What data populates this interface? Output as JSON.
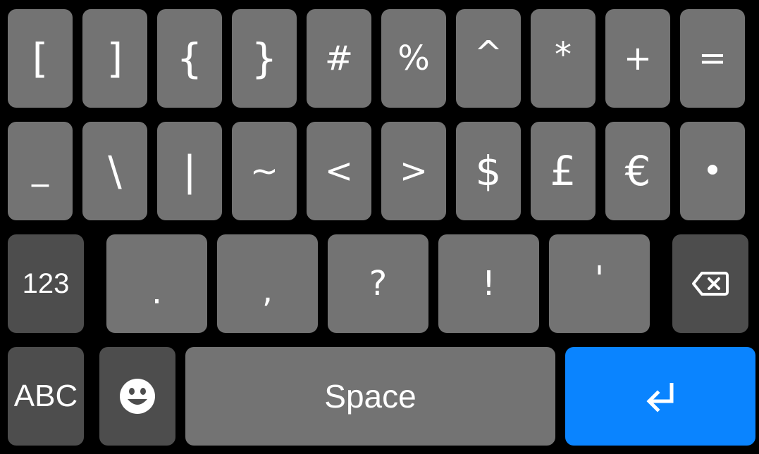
{
  "keyboard": {
    "row1": [
      "[",
      "]",
      "{",
      "}",
      "#",
      "%",
      "^",
      "*",
      "+",
      "="
    ],
    "row2": [
      "_",
      "\\",
      "|",
      "~",
      "<",
      ">",
      "$",
      "£",
      "€",
      "•"
    ],
    "row3": [
      ".",
      ",",
      "?",
      "!",
      "'"
    ],
    "mode_123": "123",
    "mode_abc": "ABC",
    "space": "Space",
    "backspace_icon": "backspace-icon",
    "emoji_icon": "smiley-icon",
    "enter_icon": "enter-arrow-icon"
  },
  "colors": {
    "background": "#000000",
    "key_light": "#737373",
    "key_dark": "#4d4d4d",
    "enter": "#0a84ff",
    "glyph": "#ffffff"
  }
}
